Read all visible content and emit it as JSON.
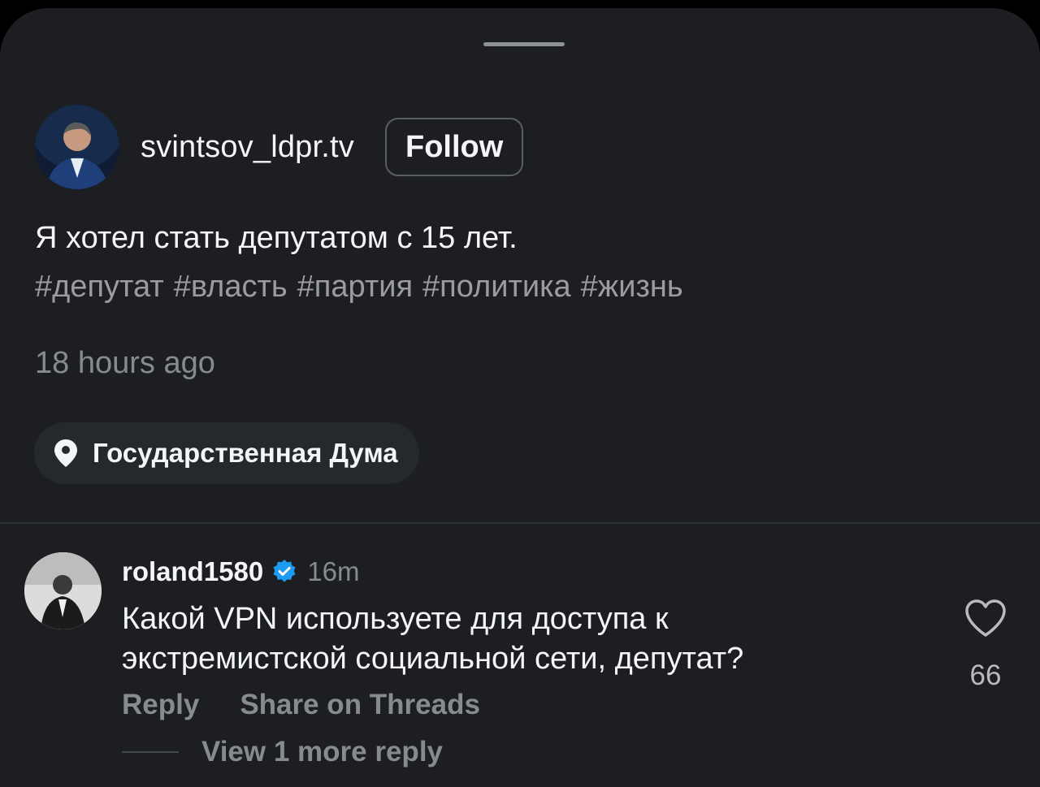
{
  "post": {
    "username": "svintsov_ldpr.tv",
    "follow_label": "Follow",
    "caption": "Я хотел стать депутатом с 15 лет.",
    "hashtags": [
      "#депутат",
      "#власть",
      "#партия",
      "#политика",
      "#жизнь"
    ],
    "timestamp": "18 hours ago",
    "location": "Государственная Дума"
  },
  "comment": {
    "username": "roland1580",
    "time": "16m",
    "text_line1": "Какой VPN используете для доступа к",
    "text_line2": "экстремистской социальной сети, депутат?",
    "reply_label": "Reply",
    "share_label": "Share on Threads",
    "view_more_label": "View 1 more reply",
    "like_count": "66"
  },
  "icons": {
    "location": "location-pin-icon",
    "verified": "verified-badge-icon",
    "like": "heart-icon"
  },
  "colors": {
    "background": "#1c1e22",
    "text": "#f3f5f7",
    "muted": "#878a8f",
    "verified": "#1d9bf0"
  }
}
